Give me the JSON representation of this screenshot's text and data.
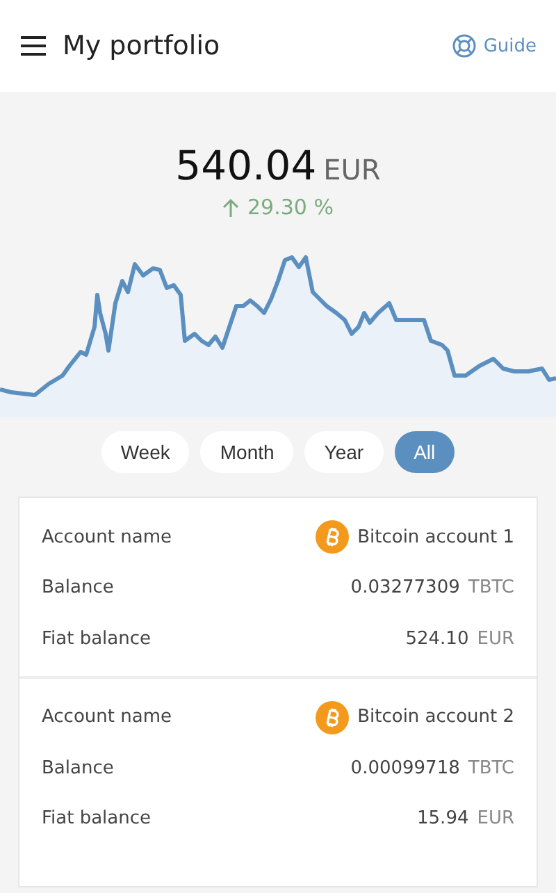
{
  "header": {
    "title": "My portfolio",
    "guide": "Guide"
  },
  "summary": {
    "amount": "540.04",
    "currency": "EUR",
    "change": "29.30 %"
  },
  "periods": [
    {
      "label": "Week",
      "selected": false
    },
    {
      "label": "Month",
      "selected": false
    },
    {
      "label": "Year",
      "selected": false
    },
    {
      "label": "All",
      "selected": true
    }
  ],
  "accounts": [
    {
      "rows": [
        {
          "kind": "name",
          "label": "Account name",
          "value": "Bitcoin account 1"
        },
        {
          "kind": "amount",
          "label": "Balance",
          "value": "0.03277309",
          "unit": "TBTC"
        },
        {
          "kind": "amount",
          "label": "Fiat balance",
          "value": "524.10",
          "unit": "EUR"
        }
      ]
    },
    {
      "rows": [
        {
          "kind": "name",
          "label": "Account name",
          "value": "Bitcoin account 2"
        },
        {
          "kind": "amount",
          "label": "Balance",
          "value": "0.00099718",
          "unit": "TBTC"
        },
        {
          "kind": "amount",
          "label": "Fiat balance",
          "value": "15.94",
          "unit": "EUR"
        }
      ]
    }
  ]
}
